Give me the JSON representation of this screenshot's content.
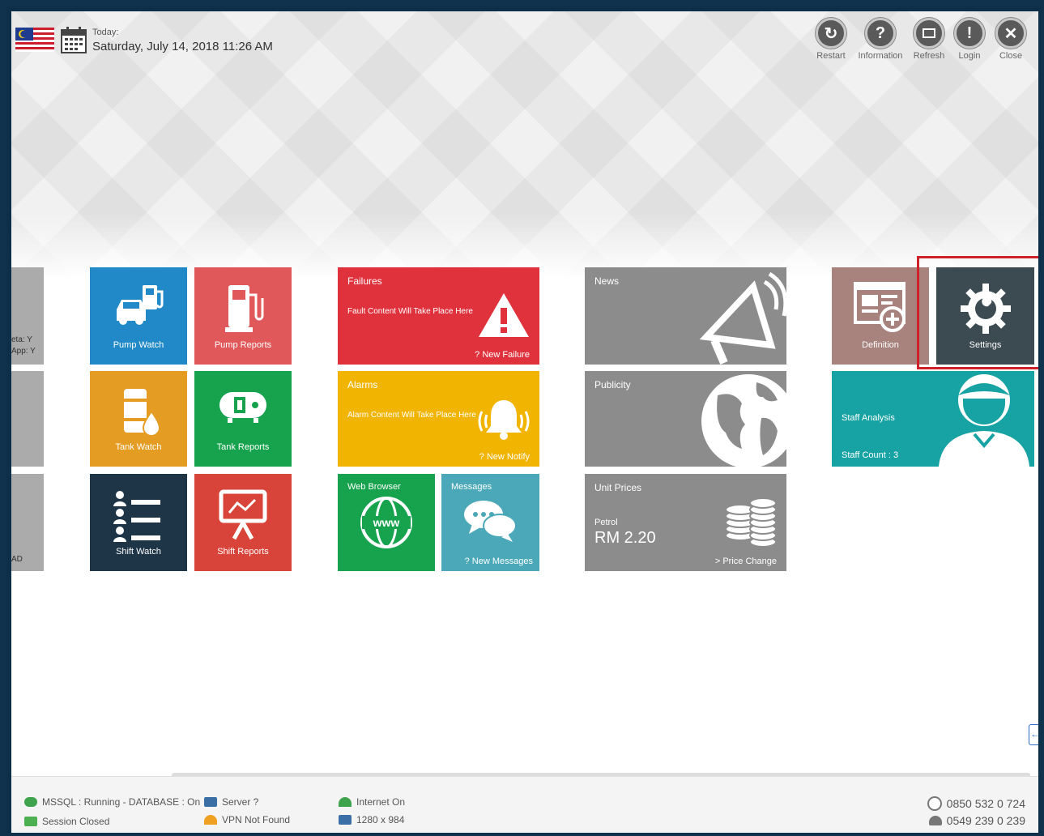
{
  "header": {
    "today_label": "Today:",
    "date_time": "Saturday, July 14, 2018 11:26 AM"
  },
  "top_buttons": [
    {
      "label": "Restart",
      "icon": "restart-icon"
    },
    {
      "label": "Information",
      "icon": "question-icon"
    },
    {
      "label": "Refresh",
      "icon": "window-icon"
    },
    {
      "label": "Login",
      "icon": "key-icon"
    },
    {
      "label": "Close",
      "icon": "close-icon"
    }
  ],
  "partial_panel": {
    "line1": "eta: Y",
    "line2": "App: Y",
    "line3": "AD"
  },
  "tiles": {
    "pump_watch": "Pump Watch",
    "pump_reports": "Pump Reports",
    "tank_watch": "Tank Watch",
    "tank_reports": "Tank Reports",
    "shift_watch": "Shift Watch",
    "shift_reports": "Shift Reports",
    "definition": "Definition",
    "settings": "Settings"
  },
  "failures": {
    "title": "Failures",
    "text": "Fault Content Will Take Place Here",
    "footer": "? New Failure"
  },
  "alarms": {
    "title": "Alarms",
    "text": "Alarm Content Will Take Place Here",
    "footer": "? New Notify"
  },
  "web_browser": {
    "title": "Web Browser"
  },
  "messages": {
    "title": "Messages",
    "footer": "? New Messages"
  },
  "news": {
    "title": "News"
  },
  "publicity": {
    "title": "Publicity"
  },
  "unit_prices": {
    "title": "Unit Prices",
    "fuel_label": "Petrol",
    "price": "RM 2.20",
    "footer": "> Price Change"
  },
  "staff": {
    "title": "Staff Analysis",
    "count": "Staff Count : 3"
  },
  "status_bar": {
    "db": "MSSQL : Running - DATABASE : On",
    "session": "Session Closed",
    "server": "Server ?",
    "vpn": "VPN Not Found",
    "internet": "Internet On",
    "resolution": "1280 x 984",
    "phone": "0850 532 0 724",
    "phone2": "0549 239 0 239"
  },
  "colors": {
    "blue": "#2289c9",
    "red_pink": "#e0585a",
    "orange": "#e59c23",
    "green": "#17a34e",
    "navy": "#1e3548",
    "red": "#d9443a",
    "failure_red": "#e0323d",
    "alarm_yellow": "#f1b400",
    "teal": "#4aa8b8",
    "gray": "#8c8c8c",
    "mauve": "#a8827c",
    "dark_slate": "#3c4a52",
    "staff_teal": "#17a2a3",
    "highlight": "#d0202a"
  }
}
